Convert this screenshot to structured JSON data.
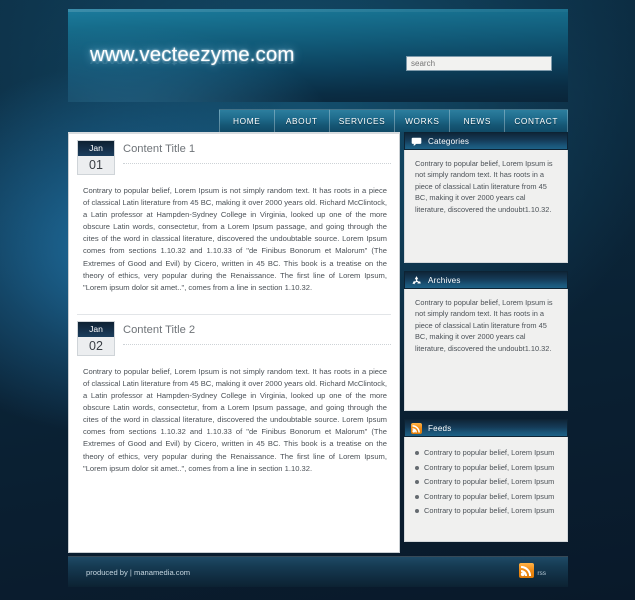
{
  "site": {
    "logo": "www.vecteezyme.com",
    "accent_teal": "#1b7b9d",
    "accent_dark": "#0c2232",
    "rss_orange": "#f08a14"
  },
  "search": {
    "placeholder": "search",
    "value": ""
  },
  "nav": {
    "items": [
      {
        "label": "HOME"
      },
      {
        "label": "ABOUT"
      },
      {
        "label": "SERVICES"
      },
      {
        "label": "WORKS"
      },
      {
        "label": "NEWS"
      },
      {
        "label": "CONTACT"
      }
    ]
  },
  "posts": [
    {
      "month": "Jan",
      "day": "01",
      "title": "Content Title 1",
      "body": "Contrary to popular belief, Lorem Ipsum is not simply random text. It has roots in a piece of classical Latin literature from 45 BC, making it over 2000 years old. Richard McClintock, a Latin professor at Hampden-Sydney College in Virginia, looked up one of the more obscure Latin words, consectetur, from a Lorem Ipsum passage, and going through the cites of the word in classical literature, discovered the undoubtable source. Lorem Ipsum comes from sections 1.10.32 and 1.10.33 of \"de Finibus Bonorum et Malorum\" (The Extremes of Good and Evil) by Cicero, written in 45 BC. This book is a treatise on the theory of ethics, very popular during the Renaissance. The first line of Lorem Ipsum, \"Lorem ipsum dolor sit amet..\", comes from a line in section 1.10.32."
    },
    {
      "month": "Jan",
      "day": "02",
      "title": "Content Title 2",
      "body": "Contrary to popular belief, Lorem Ipsum is not simply random text. It has roots in a piece of classical Latin literature from 45 BC, making it over 2000 years old. Richard McClintock, a Latin professor at Hampden-Sydney College in Virginia, looked up one of the more obscure Latin words, consectetur, from a Lorem Ipsum passage, and going through the cites of the word in classical literature, discovered the undoubtable source. Lorem Ipsum comes from sections 1.10.32 and 1.10.33 of \"de Finibus Bonorum et Malorum\" (The Extremes of Good and Evil) by Cicero, written in 45 BC. This book is a treatise on the theory of ethics, very popular during the Renaissance. The first line of Lorem Ipsum, \"Lorem ipsum dolor sit amet..\", comes from a line in section 1.10.32."
    }
  ],
  "sidebar": {
    "categories": {
      "title": "Categories",
      "icon": "speech-bubble-icon",
      "body": "Contrary to popular belief, Lorem Ipsum is not simply random text. It has roots in a piece of classical Latin literature from 45 BC, making it over 2000 years cal literature, discovered the undoubt1.10.32."
    },
    "archives": {
      "title": "Archives",
      "icon": "recycle-icon",
      "body": "Contrary to popular belief, Lorem Ipsum is not simply random text. It has roots in a piece of classical Latin literature from 45 BC, making it over 2000 years cal literature, discovered the undoubt1.10.32."
    },
    "feeds": {
      "title": "Feeds",
      "icon": "rss-icon",
      "items": [
        {
          "label": "Contrary to popular belief, Lorem Ipsum"
        },
        {
          "label": "Contrary to popular belief, Lorem Ipsum"
        },
        {
          "label": "Contrary to popular belief, Lorem Ipsum"
        },
        {
          "label": "Contrary to popular belief, Lorem Ipsum"
        },
        {
          "label": "Contrary to popular belief, Lorem Ipsum"
        }
      ]
    }
  },
  "footer": {
    "credit": "produced by | manamedia.com",
    "rss_label": "rss",
    "rss_icon": "rss-icon"
  }
}
